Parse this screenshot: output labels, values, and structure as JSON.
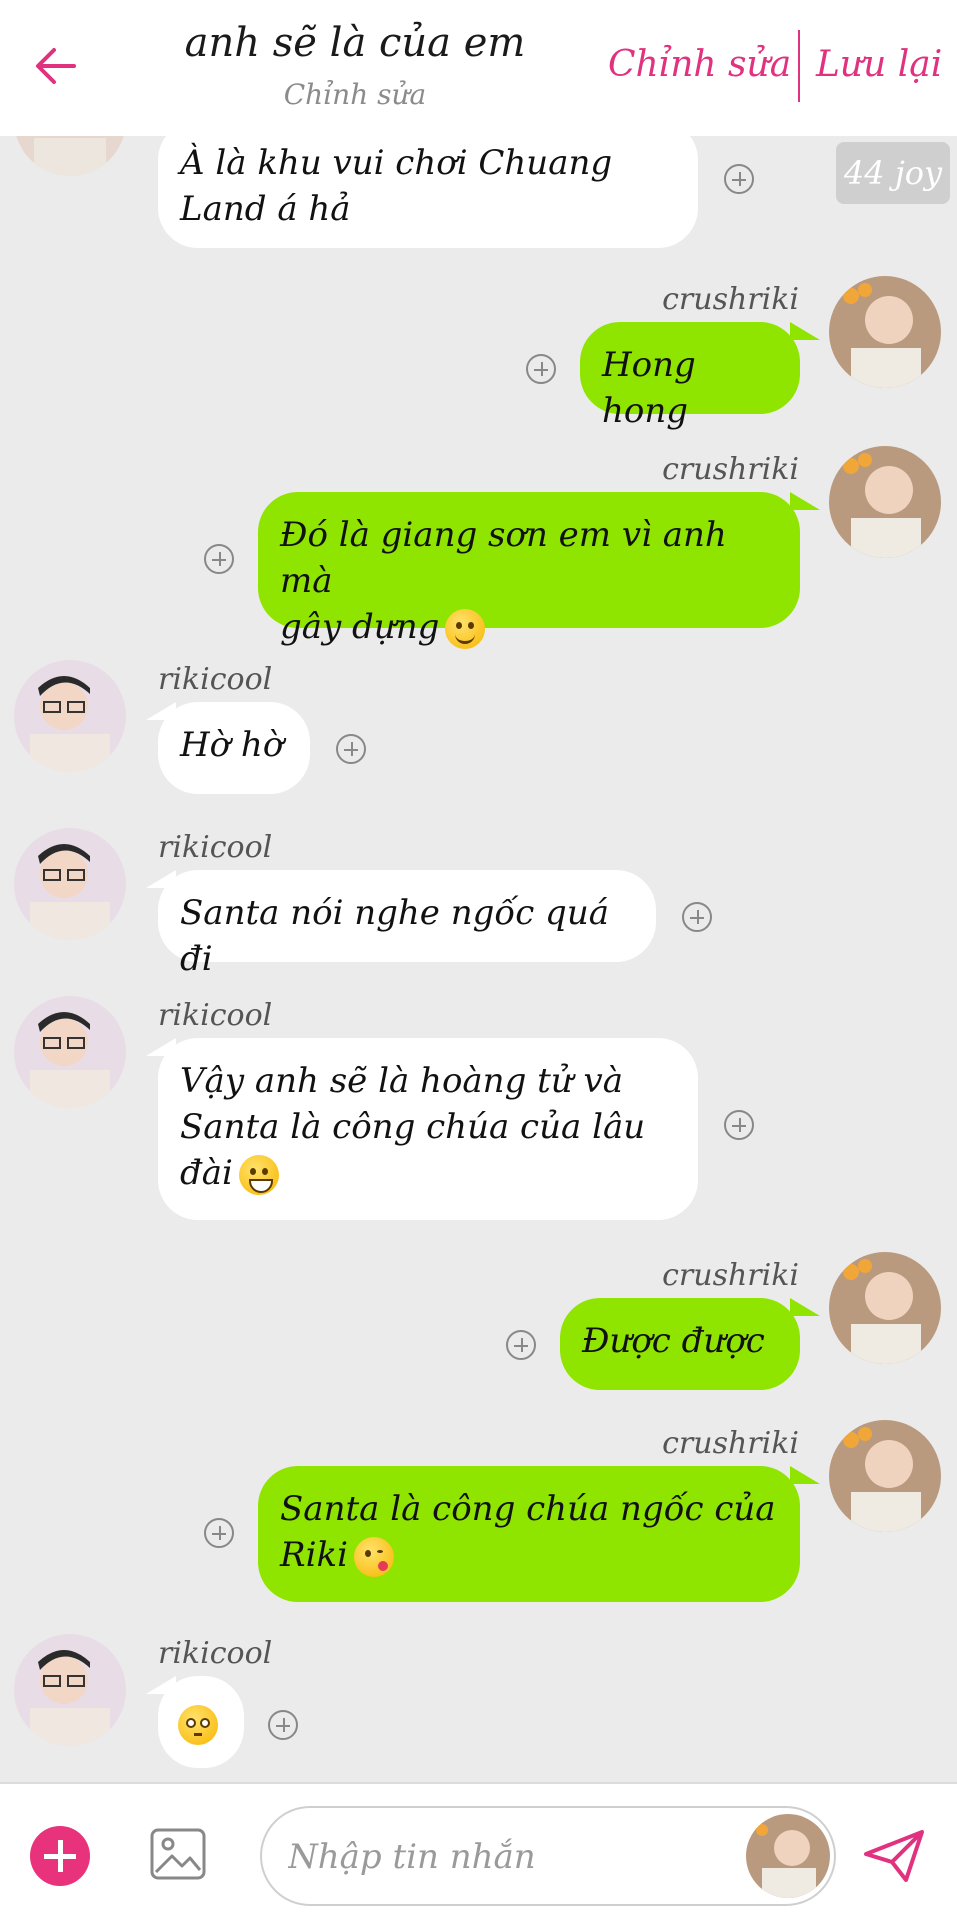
{
  "header": {
    "title": "anh sẽ là của em",
    "subtitle": "Chỉnh sửa",
    "edit_label": "Chỉnh sửa",
    "save_label": "Lưu lại"
  },
  "watermark": "44 joy",
  "colors": {
    "accent": "#e0327f",
    "sent_bubble": "#8fe400",
    "received_bubble": "#ffffff",
    "background": "#ebebeb"
  },
  "messages": [
    {
      "sender": "",
      "lines": [
        "À là khu vui chơi Chuang",
        "Land á hả"
      ]
    },
    {
      "sender": "crushriki",
      "lines": [
        "Hong hong"
      ]
    },
    {
      "sender": "crushriki",
      "lines": [
        "Đó là giang sơn em vì anh mà",
        "gây dựng"
      ],
      "emoji": "smiling-face"
    },
    {
      "sender": "rikicool",
      "lines": [
        "Hờ hờ"
      ]
    },
    {
      "sender": "rikicool",
      "lines": [
        "Santa nói nghe ngốc quá đi"
      ]
    },
    {
      "sender": "rikicool",
      "lines": [
        "Vậy anh sẽ là hoàng tử và",
        "Santa là công chúa của lâu",
        "đài"
      ],
      "emoji": "grinning-face"
    },
    {
      "sender": "crushriki",
      "lines": [
        "Được được"
      ]
    },
    {
      "sender": "crushriki",
      "lines": [
        "Santa là công chúa ngốc của",
        "Riki"
      ],
      "emoji": "kissing-face"
    },
    {
      "sender": "rikicool",
      "lines": [],
      "emoji": "flushed-face"
    }
  ],
  "composer": {
    "placeholder": "Nhập tin nhắn"
  },
  "icons": {
    "back": "arrow-left-icon",
    "add": "plus-circle-icon",
    "image": "image-icon",
    "send": "paper-plane-icon"
  }
}
